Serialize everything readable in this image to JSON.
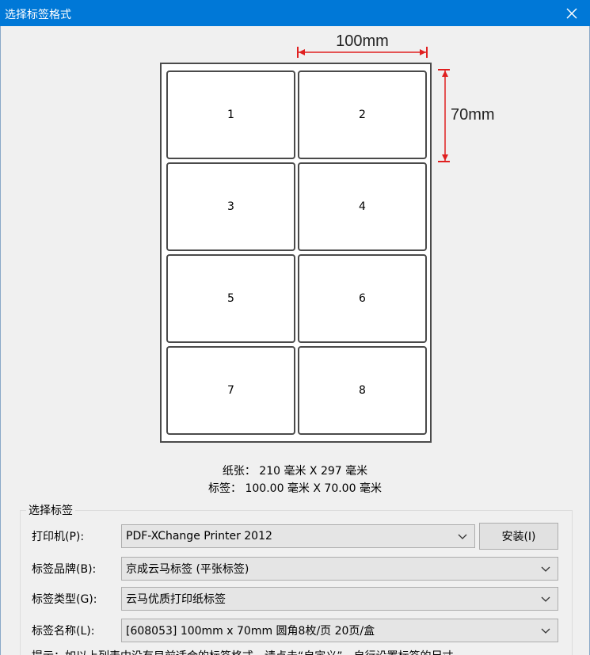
{
  "window": {
    "title": "选择标签格式"
  },
  "preview": {
    "width_label": "100mm",
    "height_label": "70mm",
    "labels": [
      "1",
      "2",
      "3",
      "4",
      "5",
      "6",
      "7",
      "8"
    ],
    "accent_color": "#e02020"
  },
  "info": {
    "paper_key": "纸张：",
    "paper_value": "210 毫米 X  297 毫米",
    "label_key": "标签：",
    "label_value": "100.00 毫米 X 70.00 毫米"
  },
  "form": {
    "group_title": "选择标签",
    "printer": {
      "label": "打印机(P):",
      "value": "PDF-XChange Printer 2012"
    },
    "install_button": "安装(I)",
    "brand": {
      "label": "标签品牌(B):",
      "value": "京成云马标签 (平张标签)"
    },
    "type": {
      "label": "标签类型(G):",
      "value": "云马优质打印纸标签"
    },
    "name": {
      "label": "标签名称(L):",
      "value": "[608053] 100mm x 70mm 圆角8枚/页 20页/盒"
    }
  },
  "hint": "提示：如以上列表中没有目前适合的标签格式，请点击“自定义”，自行设置标签的尺寸。"
}
